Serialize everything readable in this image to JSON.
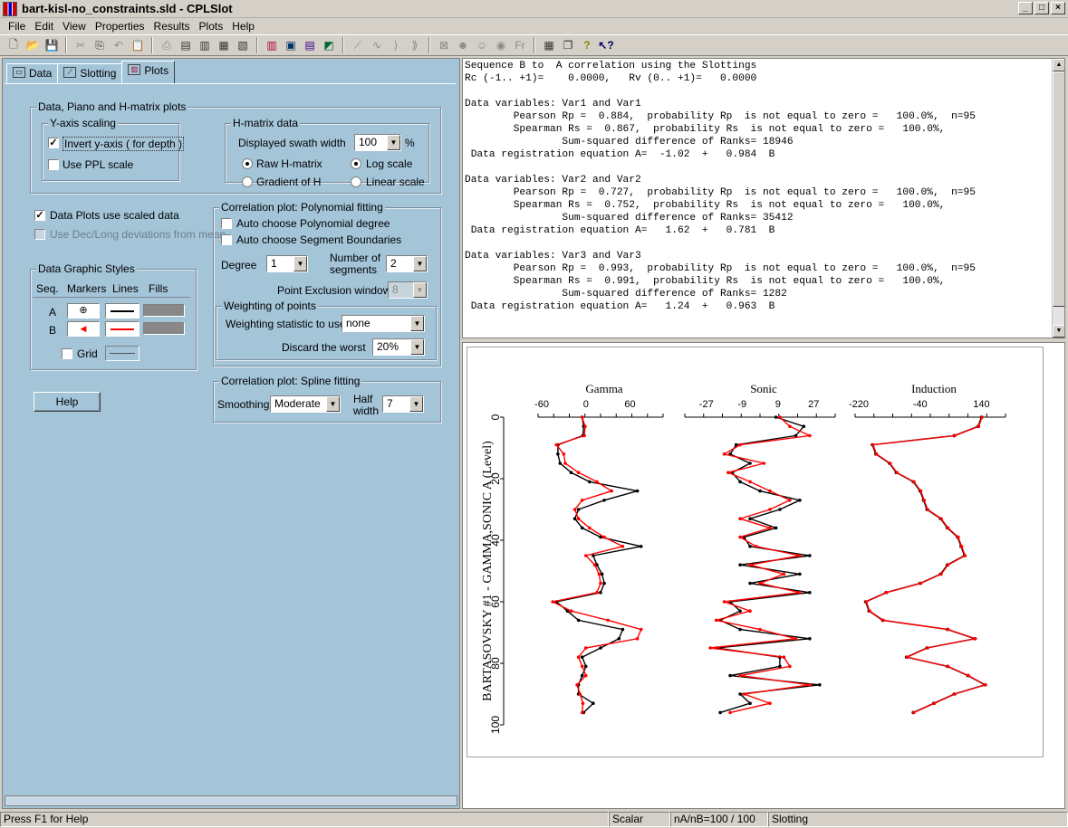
{
  "window": {
    "title": "bart-kisl-no_constraints.sld - CPLSlot"
  },
  "menu": [
    "File",
    "Edit",
    "View",
    "Properties",
    "Results",
    "Plots",
    "Help"
  ],
  "toolbar_icons": [
    "new-icon",
    "open-icon",
    "save-icon",
    "cut-icon",
    "copy-icon",
    "undo-icon",
    "paste-icon",
    "print-icon",
    "slot-icon",
    "slot2-icon",
    "slot3-icon",
    "slot4-icon",
    "plot-icon",
    "plot2-icon",
    "plot3-icon",
    "plot4-icon",
    "line-icon",
    "wave-icon",
    "bracket-icon",
    "bracket2-icon",
    "box-icon",
    "person-icon",
    "person2-icon",
    "eye-icon",
    "fr-icon",
    "calc-icon",
    "window-icon",
    "help-icon",
    "whatsthis-icon"
  ],
  "tabs": [
    {
      "label": "Data"
    },
    {
      "label": "Slotting"
    },
    {
      "label": "Plots"
    }
  ],
  "plots_tab": {
    "group_main": "Data, Piano and H-matrix plots",
    "yaxis": {
      "title": "Y-axis scaling",
      "invert_label": "Invert y-axis ( for depth )",
      "invert_checked": true,
      "ppl_label": "Use PPL scale",
      "ppl_checked": false
    },
    "hmatrix": {
      "title": "H-matrix data",
      "swath_label": "Displayed swath width",
      "swath_value": "100",
      "swath_unit": "%",
      "raw_label": "Raw H-matrix",
      "gradient_label": "Gradient of H",
      "log_label": "Log scale",
      "linear_label": "Linear scale"
    },
    "scaled_label": "Data Plots use scaled data",
    "scaled_checked": true,
    "dec_label": "Use Dec/Long deviations from mean",
    "styles": {
      "title": "Data Graphic Styles",
      "col_seq": "Seq.",
      "col_markers": "Markers",
      "col_lines": "Lines",
      "col_fills": "Fills",
      "row_a": "A",
      "row_b": "B",
      "grid_label": "Grid",
      "color_a": "#000000",
      "color_b": "#ff0000"
    },
    "help_button": "Help",
    "poly": {
      "title": "Correlation plot: Polynomial fitting",
      "auto_degree": "Auto choose Polynomial degree",
      "auto_segments": "Auto choose Segment Boundaries",
      "degree_label": "Degree",
      "degree_value": "1",
      "segments_label_1": "Number of",
      "segments_label_2": "segments",
      "segments_value": "2",
      "exclusion_label": "Point Exclusion window",
      "exclusion_value": "8"
    },
    "weighting": {
      "title": "Weighting of points",
      "stat_label": "Weighting statistic to use",
      "stat_value": "none",
      "discard_label": "Discard the worst",
      "discard_value": "20%"
    },
    "spline": {
      "title": "Correlation plot: Spline fitting",
      "smoothing_label": "Smoothing",
      "smoothing_value": "Moderate",
      "half_label_1": "Half",
      "half_label_2": "width",
      "half_value": "7"
    }
  },
  "results_text": "Sequence B to  A correlation using the Slottings\nRc (-1.. +1)=    0.0000,   Rv (0.. +1)=   0.0000\n\nData variables: Var1 and Var1\n        Pearson Rp =  0.884,  probability Rp  is not equal to zero =   100.0%,  n=95\n        Spearman Rs =  0.867,  probability Rs  is not equal to zero =   100.0%,\n                Sum-squared difference of Ranks= 18946\n Data registration equation A=  -1.02  +   0.984  B\n\nData variables: Var2 and Var2\n        Pearson Rp =  0.727,  probability Rp  is not equal to zero =   100.0%,  n=95\n        Spearman Rs =  0.752,  probability Rs  is not equal to zero =   100.0%,\n                Sum-squared difference of Ranks= 35412\n Data registration equation A=   1.62  +   0.781  B\n\nData variables: Var3 and Var3\n        Pearson Rp =  0.993,  probability Rp  is not equal to zero =   100.0%,  n=95\n        Spearman Rs =  0.991,  probability Rs  is not equal to zero =   100.0%,\n                Sum-squared difference of Ranks= 1282\n Data registration equation A=   1.24  +   0.963  B",
  "chart_data": {
    "type": "line",
    "ylabel": "BARTASOVSKY #1 - GAMMA,SONIC A (Level)",
    "y_ticks": [
      0,
      20,
      40,
      60,
      80,
      100
    ],
    "ylim": [
      0,
      100
    ],
    "series_colors": {
      "A": "#000000",
      "B": "#ff0000"
    },
    "panels": [
      {
        "title": "Gamma",
        "x_ticks": [
          "-60",
          "0",
          "60"
        ],
        "xlim": [
          -60,
          100
        ],
        "levels": [
          0,
          3,
          6,
          9,
          12,
          15,
          18,
          21,
          24,
          27,
          30,
          33,
          36,
          39,
          42,
          45,
          48,
          51,
          54,
          57,
          60,
          63,
          66,
          69,
          72,
          75,
          78,
          81,
          84,
          87,
          90,
          93,
          96
        ],
        "series": [
          {
            "name": "A",
            "values": [
              -5,
              -3,
              -4,
              -38,
              -38,
              -35,
              -20,
              5,
              70,
              25,
              -10,
              -15,
              -5,
              20,
              75,
              10,
              15,
              22,
              25,
              20,
              -40,
              -25,
              -10,
              50,
              45,
              20,
              -5,
              0,
              -5,
              -10,
              -10,
              10,
              -3
            ]
          },
          {
            "name": "B",
            "values": [
              -5,
              -1,
              -2,
              -40,
              -30,
              -28,
              -10,
              15,
              35,
              -5,
              -15,
              -10,
              5,
              25,
              50,
              0,
              12,
              18,
              20,
              15,
              -45,
              -20,
              30,
              75,
              70,
              0,
              -10,
              -5,
              0,
              -12,
              -8,
              -4,
              -5
            ]
          }
        ]
      },
      {
        "title": "Sonic",
        "x_ticks": [
          "-27",
          "-9",
          "9",
          "27"
        ],
        "xlim": [
          -36,
          36
        ],
        "levels": [
          0,
          3,
          6,
          9,
          12,
          15,
          18,
          21,
          24,
          27,
          30,
          33,
          36,
          39,
          42,
          45,
          48,
          51,
          54,
          57,
          60,
          63,
          66,
          69,
          72,
          75,
          78,
          81,
          84,
          87,
          90,
          93,
          96
        ],
        "series": [
          {
            "name": "A",
            "values": [
              8,
              22,
              18,
              -12,
              -15,
              -5,
              -14,
              -10,
              0,
              20,
              10,
              -5,
              8,
              -8,
              -5,
              25,
              -10,
              20,
              -5,
              25,
              -15,
              -10,
              -20,
              -10,
              25,
              -22,
              10,
              10,
              -15,
              30,
              -10,
              -5,
              -20
            ]
          },
          {
            "name": "B",
            "values": [
              10,
              15,
              25,
              -10,
              -18,
              2,
              -16,
              -5,
              5,
              15,
              5,
              -10,
              5,
              -10,
              -2,
              20,
              -5,
              12,
              0,
              20,
              -18,
              -5,
              -22,
              0,
              18,
              -25,
              12,
              15,
              -10,
              25,
              -8,
              5,
              -15
            ]
          }
        ]
      },
      {
        "title": "Induction",
        "x_ticks": [
          "-220",
          "-40",
          "140"
        ],
        "xlim": [
          -220,
          200
        ],
        "levels": [
          0,
          3,
          6,
          9,
          12,
          15,
          18,
          21,
          24,
          27,
          30,
          33,
          36,
          39,
          42,
          45,
          48,
          51,
          54,
          57,
          60,
          63,
          66,
          69,
          72,
          75,
          78,
          81,
          84,
          87,
          90,
          93,
          96
        ],
        "series": [
          {
            "name": "A",
            "values": [
              140,
              130,
              60,
              -180,
              -170,
              -130,
              -110,
              -60,
              -40,
              -30,
              -20,
              20,
              40,
              70,
              80,
              90,
              40,
              20,
              -40,
              -140,
              -200,
              -190,
              -150,
              40,
              120,
              -20,
              -80,
              40,
              100,
              150,
              60,
              0,
              -60
            ]
          },
          {
            "name": "B",
            "values": [
              142,
              132,
              62,
              -178,
              -168,
              -128,
              -108,
              -58,
              -38,
              -28,
              -18,
              22,
              42,
              72,
              82,
              92,
              42,
              22,
              -38,
              -138,
              -198,
              -188,
              -148,
              42,
              122,
              -18,
              -78,
              42,
              102,
              152,
              62,
              2,
              -58
            ]
          }
        ]
      }
    ]
  },
  "status": {
    "help": "Press F1 for Help",
    "scalar": "Scalar",
    "ratio": "nA/nB=100 / 100",
    "mode": "Slotting"
  }
}
